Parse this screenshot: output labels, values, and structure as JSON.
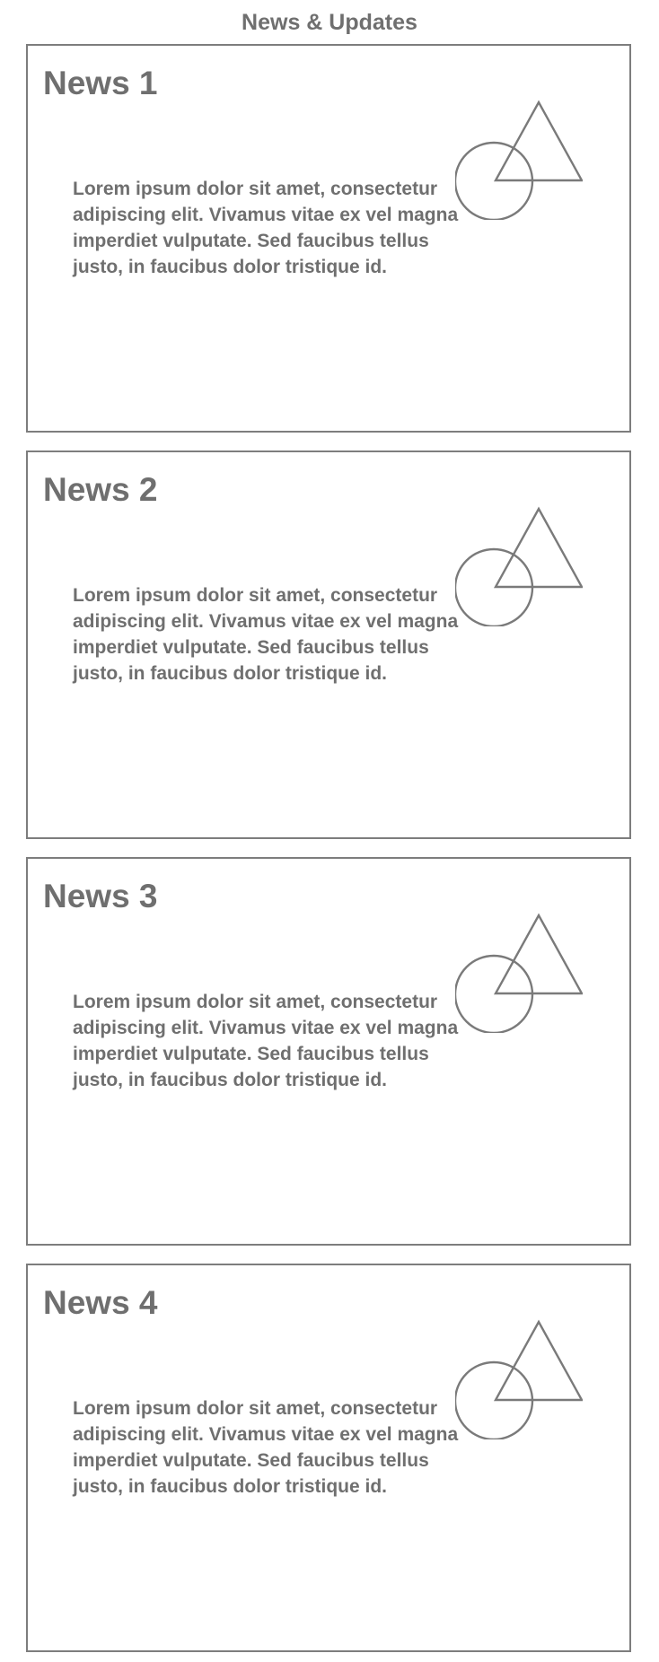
{
  "header": {
    "title": "News & Updates"
  },
  "news": [
    {
      "title": "News 1",
      "body": "Lorem ipsum dolor sit amet, consectetur adipiscing elit. Vivamus vitae ex vel magna imperdiet vulputate. Sed faucibus tellus justo, in faucibus dolor tristique id.",
      "image_icon": "image-placeholder-icon"
    },
    {
      "title": "News 2",
      "body": "Lorem ipsum dolor sit amet, consectetur adipiscing elit. Vivamus vitae ex vel magna imperdiet vulputate. Sed faucibus tellus justo, in faucibus dolor tristique id.",
      "image_icon": "image-placeholder-icon"
    },
    {
      "title": "News 3",
      "body": "Lorem ipsum dolor sit amet, consectetur adipiscing elit. Vivamus vitae ex vel magna imperdiet vulputate. Sed faucibus tellus justo, in faucibus dolor tristique id.",
      "image_icon": "image-placeholder-icon"
    },
    {
      "title": "News 4",
      "body": "Lorem ipsum dolor sit amet, consectetur adipiscing elit. Vivamus vitae ex vel magna imperdiet vulputate. Sed faucibus tellus justo, in faucibus dolor tristique id.",
      "image_icon": "image-placeholder-icon"
    }
  ],
  "colors": {
    "text": "#6f6f6f",
    "border": "#7d7d7d",
    "icon_stroke": "#7a7a7a",
    "background": "#ffffff"
  }
}
